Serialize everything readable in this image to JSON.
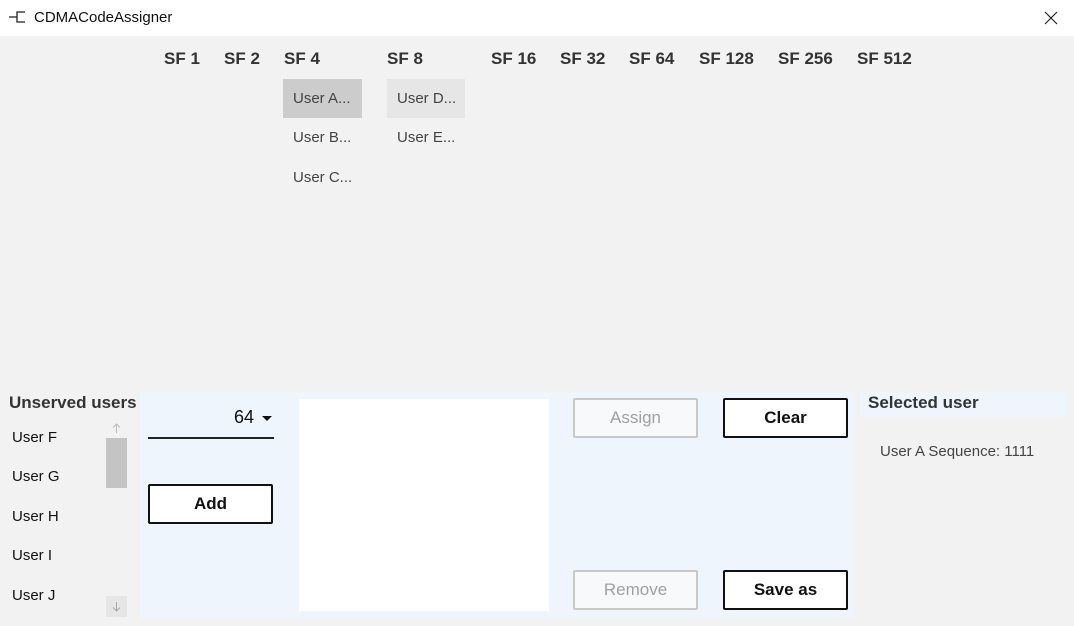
{
  "window": {
    "title": "CDMACodeAssigner",
    "close_icon": "close-icon",
    "app_icon": "app-icon"
  },
  "tree": {
    "headers": [
      "SF 1",
      "SF 2",
      "SF 4",
      "SF 8",
      "SF 16",
      "SF 32",
      "SF 64",
      "SF 128",
      "SF 256",
      "SF 512"
    ],
    "sf4_users": [
      "User A...",
      "User B...",
      "User C..."
    ],
    "sf8_users": [
      "User D...",
      "User E..."
    ],
    "selected_user": "User A...",
    "hovered_user": "User D..."
  },
  "unserved": {
    "title": "Unserved users",
    "items": [
      "User F",
      "User G",
      "User H",
      "User I",
      "User J"
    ],
    "scroll_up_icon": "arrow-up-icon",
    "scroll_down_icon": "arrow-down-icon"
  },
  "controls": {
    "sf_select_value": "64",
    "add_label": "Add",
    "assign_label": "Assign",
    "remove_label": "Remove",
    "clear_label": "Clear",
    "save_as_label": "Save as",
    "text_box_value": ""
  },
  "selected": {
    "title": "Selected user",
    "detail": "User A Sequence: 1111"
  },
  "colors": {
    "panel_bg": "#eef5fd",
    "selected_chip": "#cccccc",
    "hover_chip": "#e6e6e6",
    "window_bg": "#f2f2f2"
  }
}
